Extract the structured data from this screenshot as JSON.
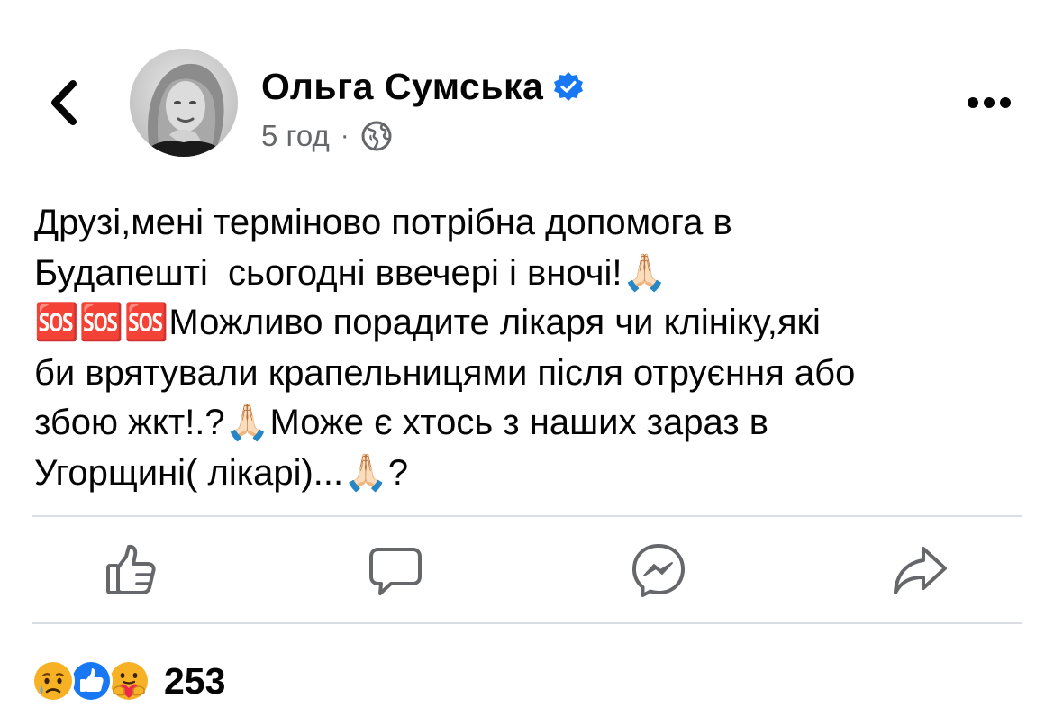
{
  "post": {
    "author": "Ольга Сумська",
    "time": "5 год",
    "separator": "·",
    "text": "Друзі,мені терміново потрібна допомога в\nБудапешті  сьогодні ввечері і вночі!🙏🏻\n🆘🆘🆘Можливо порадите лікаря чи клініку,які\nби врятували крапельницями після отруєння або\nзбою жкт!.?🙏🏻Може є хтось з наших зараз в\nУгорщині( лікарі)...🙏🏻?"
  },
  "icons": {
    "back": "chevron-left-icon",
    "verified": "verified-badge-icon",
    "audience": "globe-icon",
    "more": "more-horizontal-icon",
    "like": "thumbs-up-icon",
    "comment": "comment-bubble-icon",
    "messenger": "messenger-icon",
    "share": "share-arrow-icon",
    "reactions": [
      "sad-reaction-icon",
      "like-reaction-icon",
      "care-reaction-icon"
    ]
  },
  "reactions": {
    "count": "253"
  },
  "colors": {
    "verified": "#1877f2",
    "like_reaction": "#1877f2",
    "sad_reaction": "#f7b125",
    "care_reaction": "#f7b125",
    "meta_text": "#65676b",
    "divider": "#dadde1"
  }
}
